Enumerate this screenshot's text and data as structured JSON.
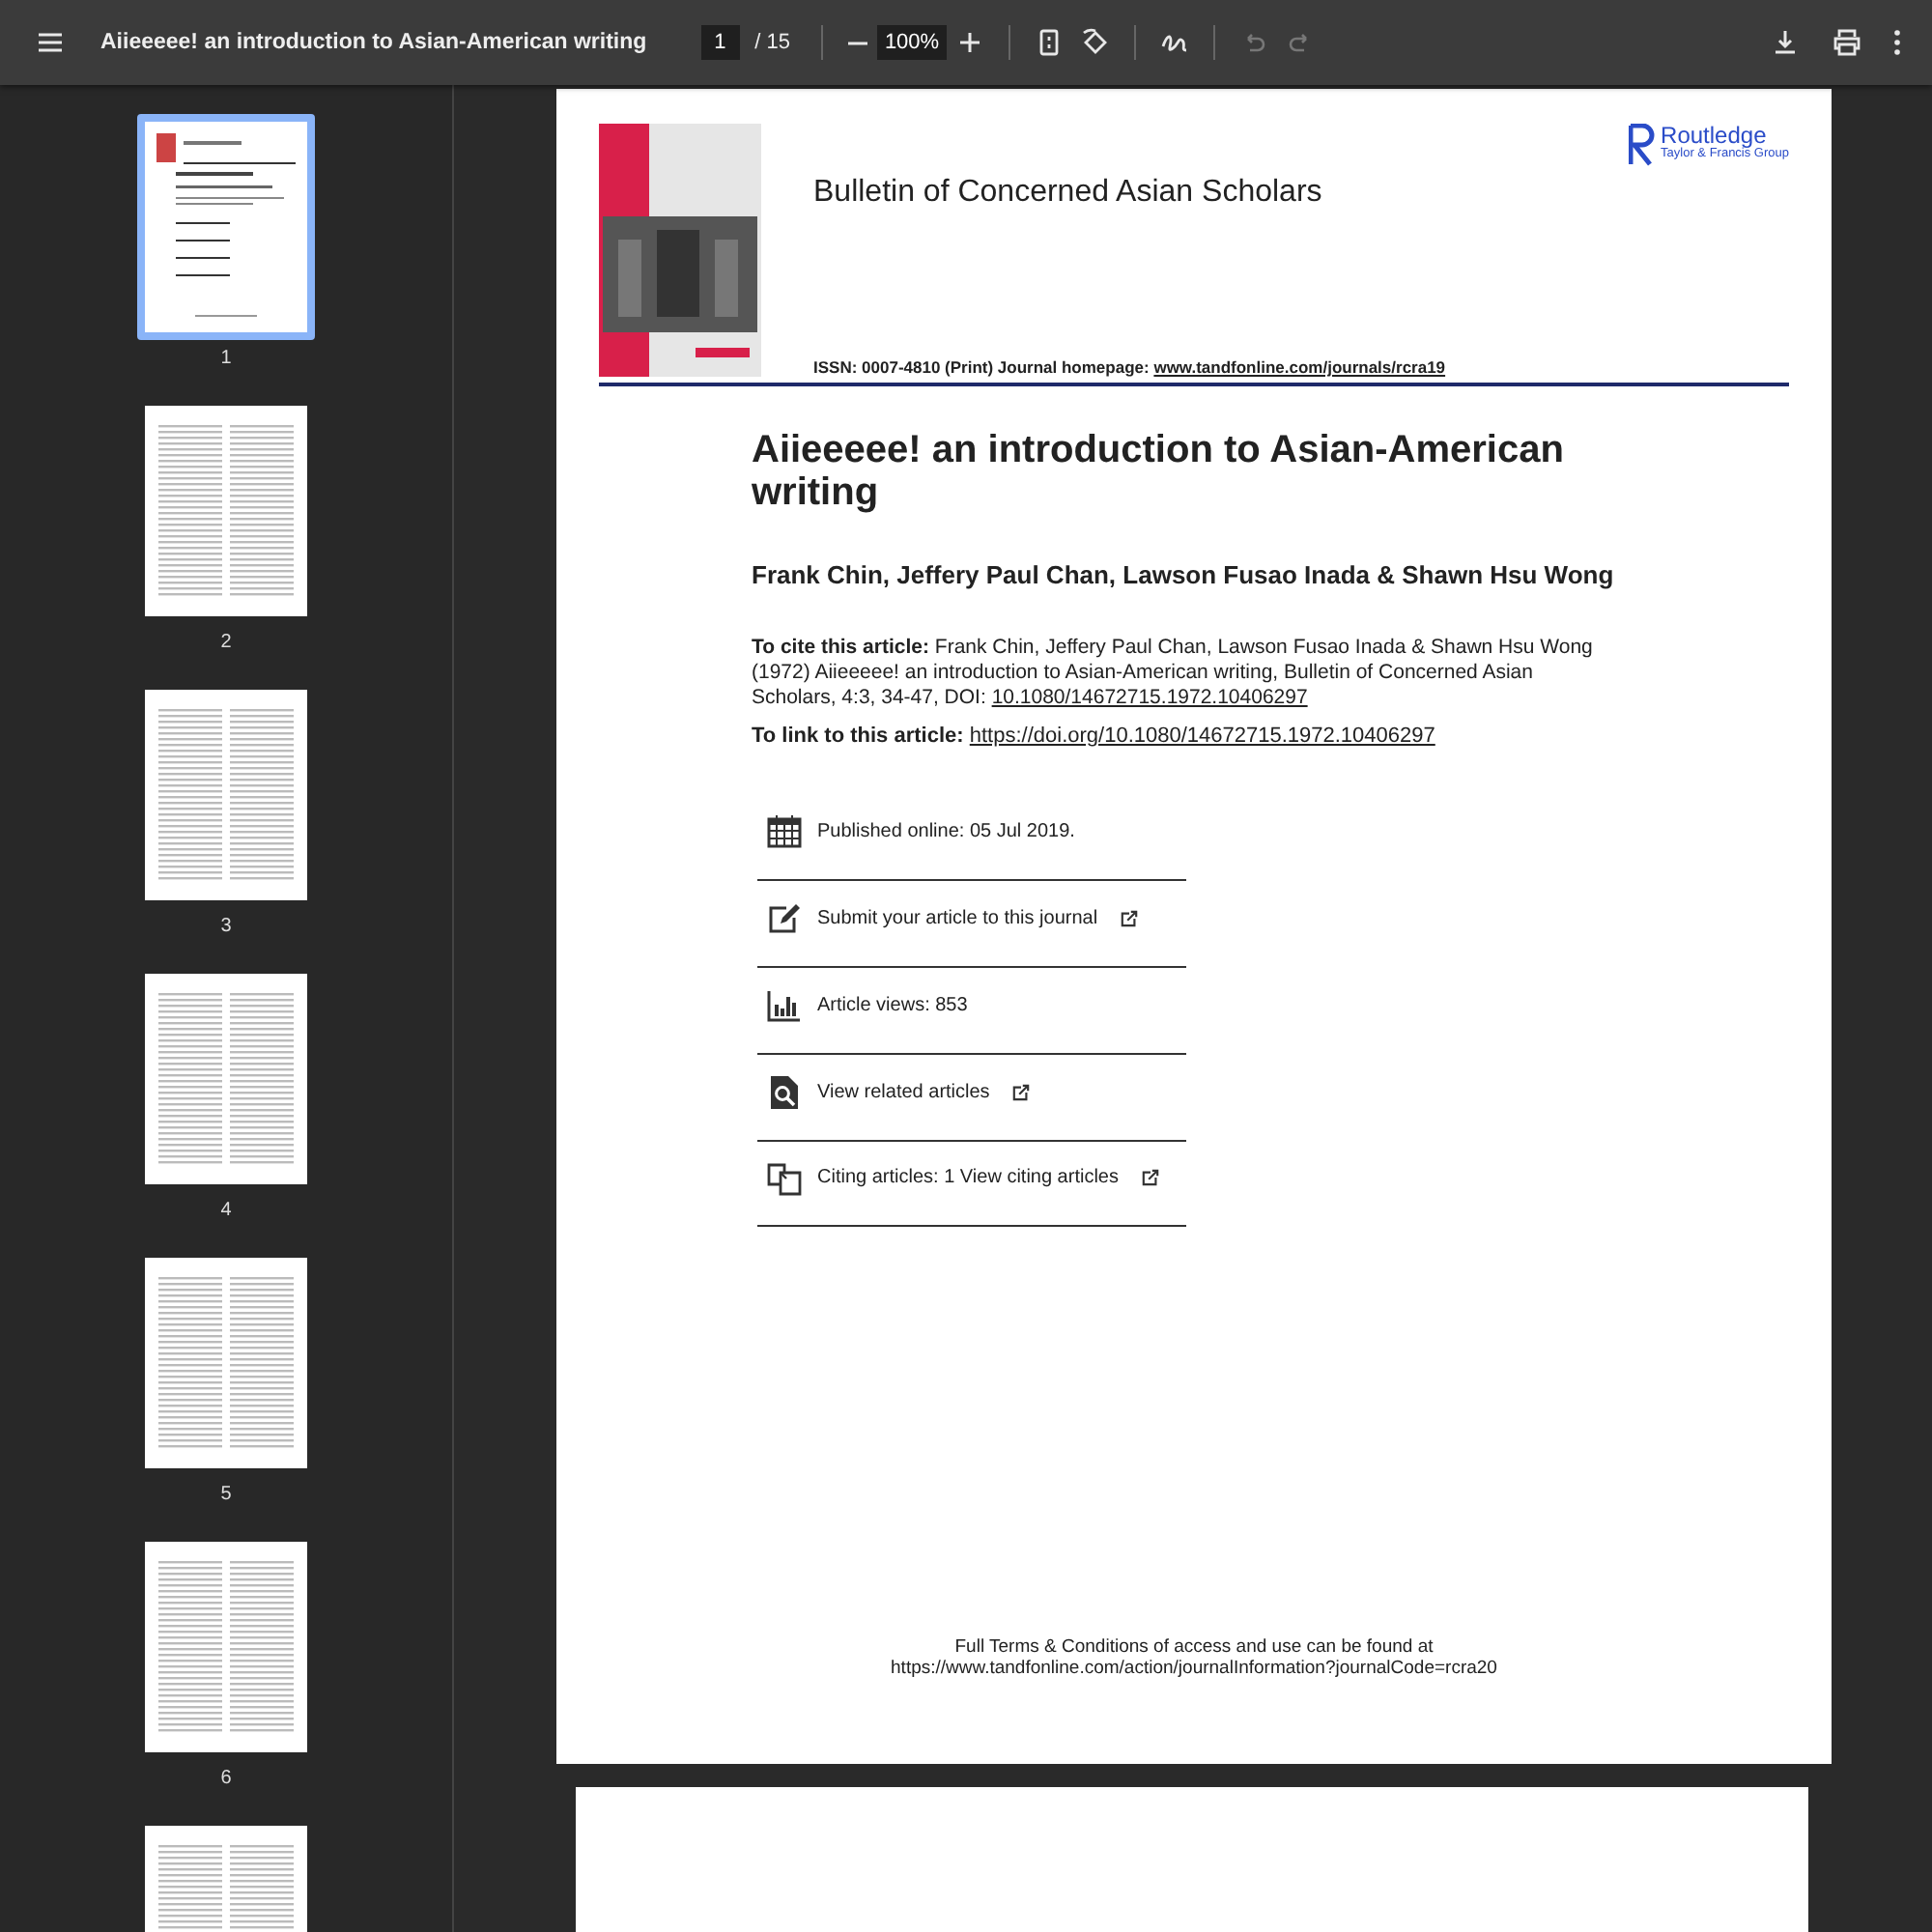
{
  "toolbar": {
    "title": "Aiieeeee! an introduction to Asian-American writing",
    "page_input": "1",
    "page_total": "/ 15",
    "zoom": "100%",
    "buttons": [
      {
        "kind": "fit",
        "disabled": false
      },
      {
        "kind": "rotate",
        "disabled": false
      },
      {
        "kind": "draw",
        "disabled": false
      },
      {
        "kind": "undo",
        "disabled": true
      },
      {
        "kind": "redo",
        "disabled": true
      }
    ]
  },
  "thumbnails": [
    {
      "label": "1",
      "selected": true
    },
    {
      "label": "2",
      "selected": false
    },
    {
      "label": "3",
      "selected": false
    },
    {
      "label": "4",
      "selected": false
    },
    {
      "label": "5",
      "selected": false
    },
    {
      "label": "6",
      "selected": false
    },
    {
      "selected": false
    }
  ],
  "document": {
    "journal": "Bulletin of Concerned Asian Scholars",
    "issn": "ISSN: 0007-4810 (Print) Journal homepage: ",
    "homepage": "www.tandfonline.com/journals/rcra19",
    "publisher": "Routledge",
    "publisher_group": "Taylor & Francis Group",
    "title": "Aiieeeee! an introduction to Asian-American writing",
    "authors": "Frank Chin, Jeffery Paul Chan, Lawson Fusao Inada & Shawn Hsu Wong",
    "cite_label": "To cite this article:",
    "cite_text": "Frank Chin, Jeffery Paul Chan, Lawson Fusao Inada & Shawn Hsu Wong (1972) Aiieeeee! an introduction to Asian-American writing, Bulletin of Concerned Asian Scholars, 4:3, 34-47, DOI: ",
    "cite_doi": "10.1080/14672715.1972.10406297",
    "link_label": "To link to this article:",
    "link_url": "https://doi.org/10.1080/14672715.1972.10406297",
    "info": [
      {
        "kind": "calendar",
        "text": "Published online: 05 Jul 2019.",
        "external": false
      },
      {
        "kind": "edit",
        "text": "Submit your article to this journal",
        "external": true
      },
      {
        "kind": "views",
        "text": "Article views: 853",
        "external": false
      },
      {
        "kind": "related",
        "text": "View related articles",
        "external": true
      },
      {
        "kind": "citing",
        "text": "Citing articles: 1 View citing articles",
        "external": true
      }
    ],
    "footer": [
      "Full Terms & Conditions of access and use can be found at",
      "https://www.tandfonline.com/action/journalInformation?journalCode=rcra20"
    ]
  }
}
